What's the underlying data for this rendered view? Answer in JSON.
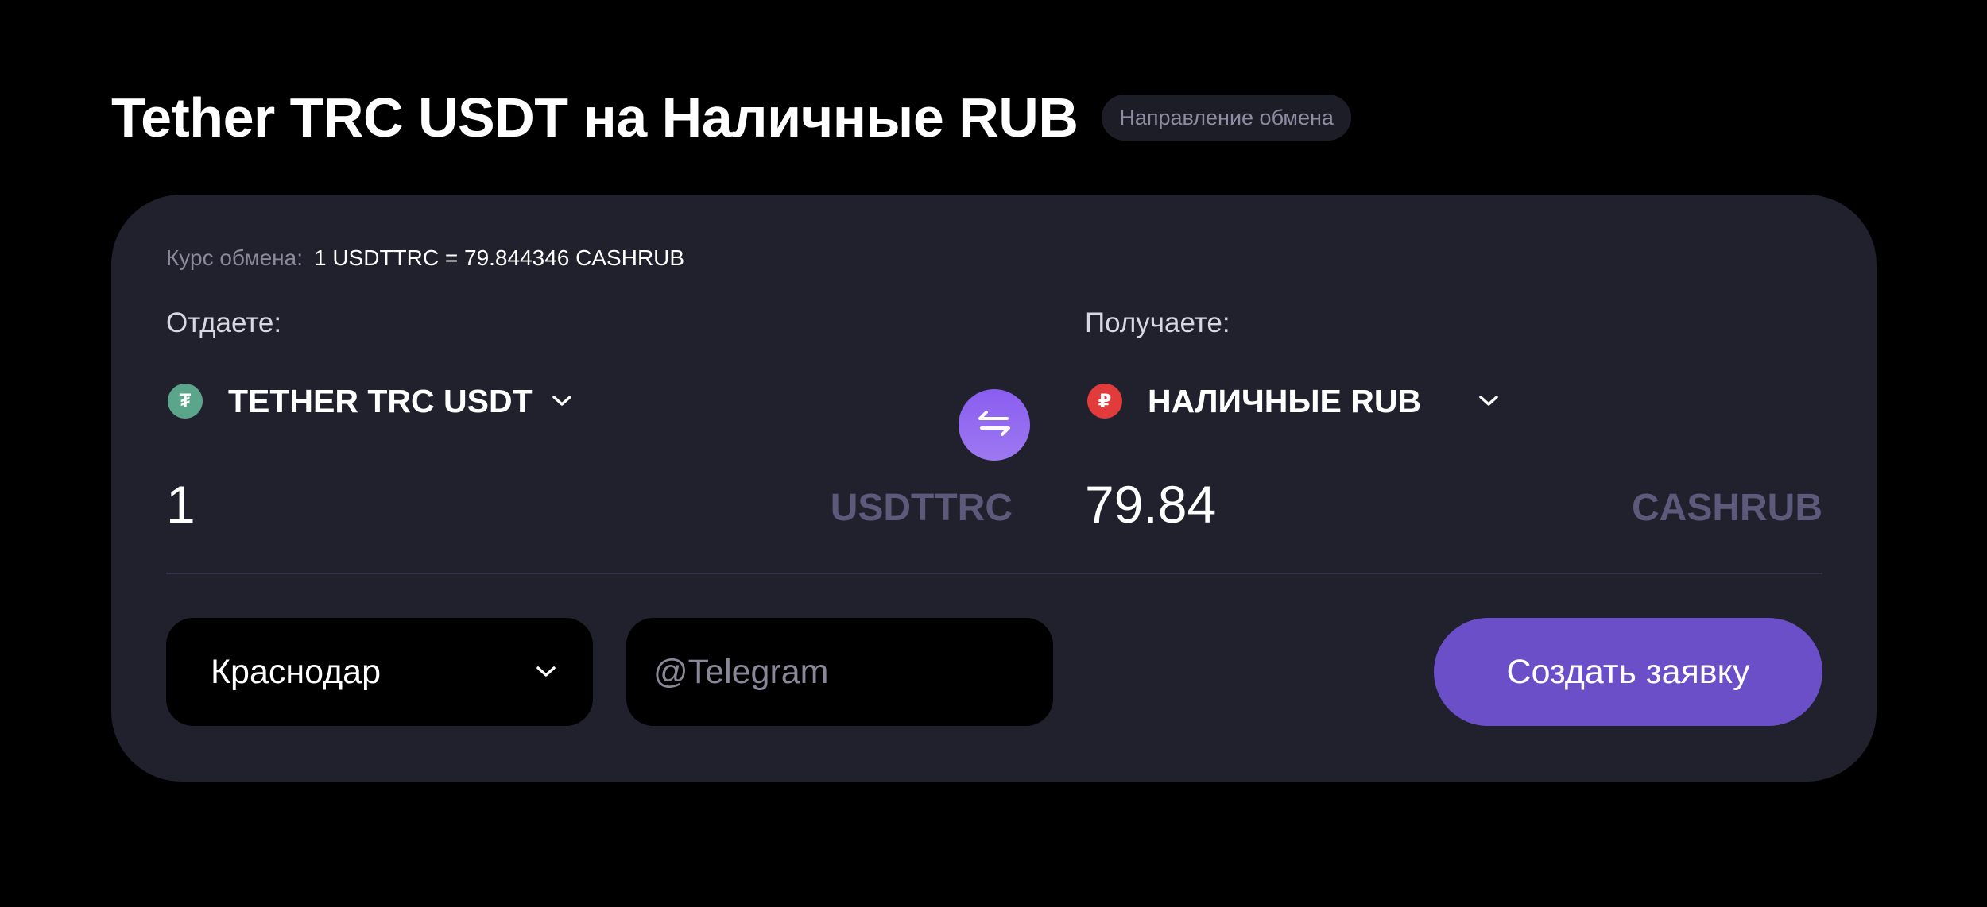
{
  "header": {
    "title": "Tether TRC USDT на Наличные RUB",
    "badge": "Направление обмена"
  },
  "exchange": {
    "rate_label": "Курс обмена:",
    "rate_value": "1 USDTTRC = 79.844346 CASHRUB",
    "give": {
      "label": "Отдаете:",
      "currency_name": "TETHER TRC USDT",
      "icon": "tether-icon",
      "icon_glyph": "₮",
      "amount": "1",
      "unit": "USDTTRC"
    },
    "receive": {
      "label": "Получаете:",
      "currency_name": "НАЛИЧНЫЕ RUB",
      "icon": "ruble-icon",
      "icon_glyph": "₽",
      "amount": "79.84",
      "unit": "CASHRUB"
    },
    "swap_icon": "swap-arrows-icon"
  },
  "form": {
    "city": "Краснодар",
    "telegram_placeholder": "@Telegram",
    "telegram_value": "",
    "submit_label": "Создать заявку"
  },
  "colors": {
    "background": "#000000",
    "card": "#21212e",
    "accent": "#6b4fc8",
    "swap_gradient_top": "#8a5ef0",
    "tether_green": "#5ba58b",
    "ruble_red": "#e23b3b",
    "unit_text": "#5c5a7a"
  }
}
